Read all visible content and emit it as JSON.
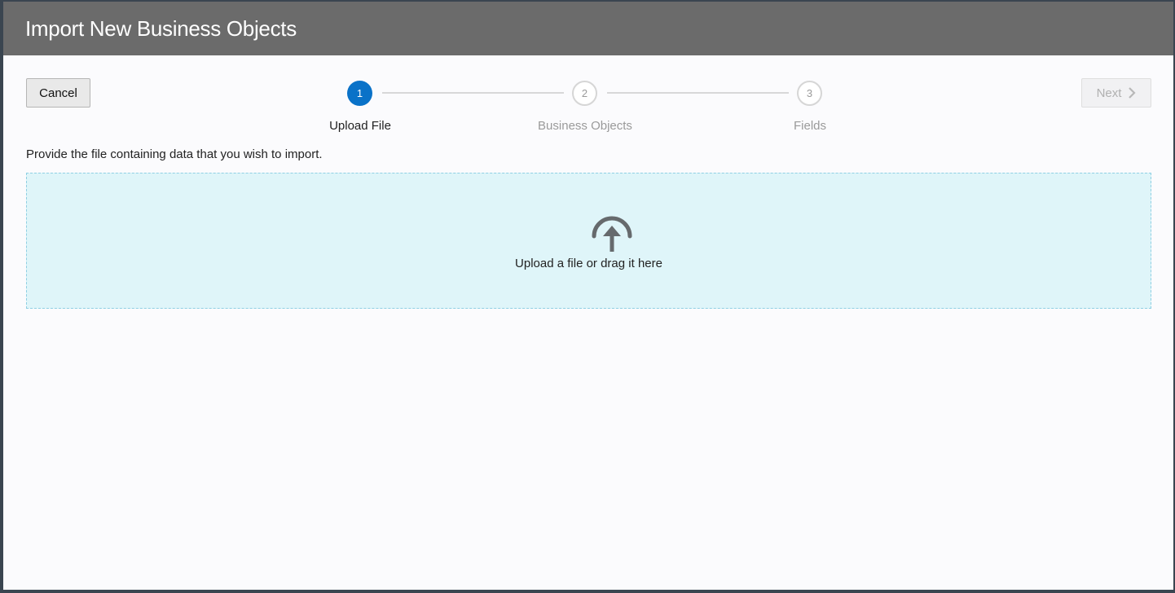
{
  "dialog": {
    "title": "Import New Business Objects"
  },
  "toolbar": {
    "cancel_label": "Cancel",
    "next_label": "Next"
  },
  "steps": [
    {
      "number": "1",
      "label": "Upload File",
      "state": "active"
    },
    {
      "number": "2",
      "label": "Business Objects",
      "state": "inactive"
    },
    {
      "number": "3",
      "label": "Fields",
      "state": "inactive"
    }
  ],
  "instruction": "Provide the file containing data that you wish to import.",
  "dropzone": {
    "label": "Upload a file or drag it here",
    "icon": "upload-icon"
  },
  "colors": {
    "titlebar": "#6b6b6b",
    "active_step": "#0a72c8",
    "dropzone_bg": "#dff5f9"
  }
}
